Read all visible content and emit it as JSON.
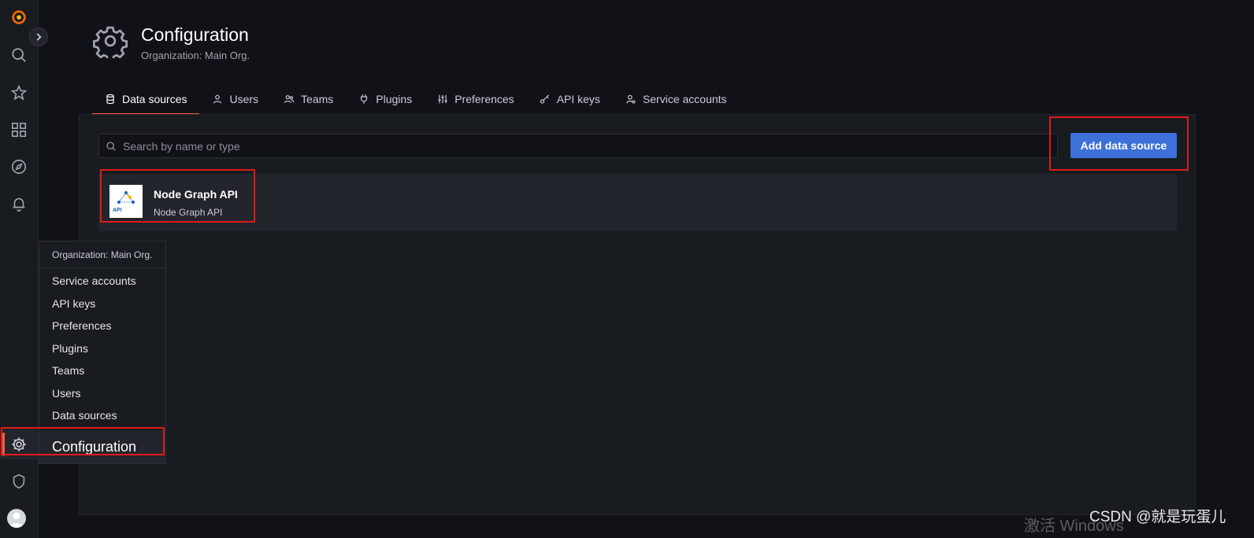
{
  "header": {
    "title": "Configuration",
    "subtitle": "Organization: Main Org."
  },
  "tabs": [
    {
      "label": "Data sources",
      "icon": "database-icon",
      "active": true
    },
    {
      "label": "Users",
      "icon": "user-icon"
    },
    {
      "label": "Teams",
      "icon": "users-icon"
    },
    {
      "label": "Plugins",
      "icon": "plug-icon"
    },
    {
      "label": "Preferences",
      "icon": "sliders-icon"
    },
    {
      "label": "API keys",
      "icon": "key-icon"
    },
    {
      "label": "Service accounts",
      "icon": "user-cog-icon"
    }
  ],
  "search": {
    "placeholder": "Search by name or type",
    "value": ""
  },
  "add_button": {
    "label": "Add data source"
  },
  "data_sources": [
    {
      "name": "Node Graph API",
      "type": "Node Graph API",
      "logo": "node-graph-api-logo",
      "logo_text": "API"
    }
  ],
  "flyout": {
    "header": "Organization: Main Org.",
    "items": [
      "Service accounts",
      "API keys",
      "Preferences",
      "Plugins",
      "Teams",
      "Users",
      "Data sources"
    ],
    "title": "Configuration"
  },
  "sidebar": {
    "icons": [
      "grafana-logo-icon",
      "search-icon",
      "star-icon",
      "dashboards-grid-icon",
      "explore-compass-icon",
      "alert-bell-icon",
      "gear-icon",
      "shield-icon",
      "avatar"
    ]
  },
  "watermarks": {
    "windows": "激活 Windows",
    "csdn": "CSDN @就是玩蛋儿"
  },
  "colors": {
    "accent": "#f55f3e",
    "primary_button": "#3d71d9",
    "highlight": "#e01b1b",
    "background": "#111217",
    "panel": "#181b1f"
  }
}
